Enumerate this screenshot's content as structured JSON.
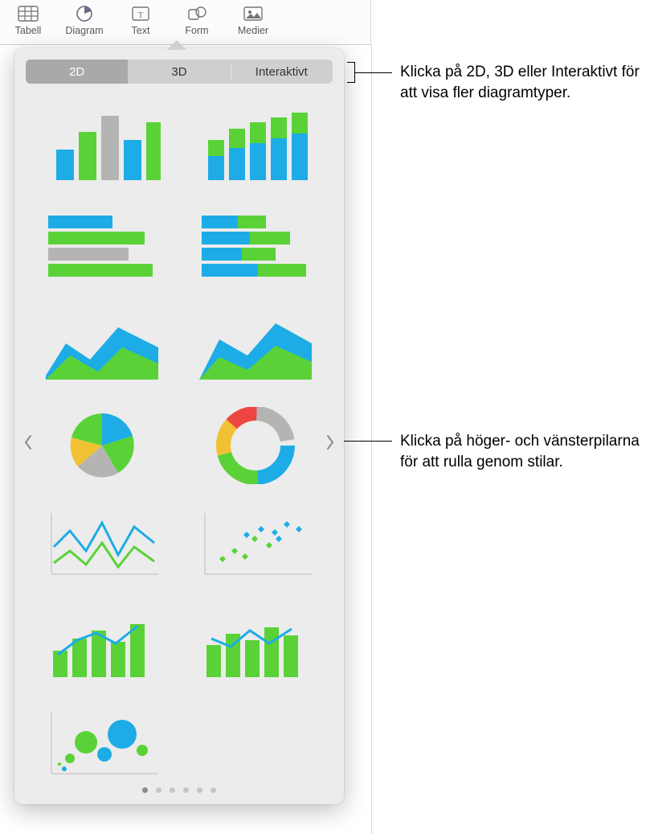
{
  "toolbar": {
    "items": [
      {
        "label": "Tabell"
      },
      {
        "label": "Diagram"
      },
      {
        "label": "Text"
      },
      {
        "label": "Form"
      },
      {
        "label": "Medier"
      }
    ]
  },
  "segmented": {
    "tabs": [
      {
        "label": "2D"
      },
      {
        "label": "3D"
      },
      {
        "label": "Interaktivt"
      }
    ]
  },
  "callouts": {
    "top": "Klicka på 2D, 3D eller Interaktivt för att visa fler diagramtyper.",
    "arrows": "Klicka på höger- och vänsterpilarna för att rulla genom stilar."
  },
  "colors": {
    "blue": "#1dace6",
    "green": "#5ad237",
    "gray": "#b4b4b3",
    "yellow": "#f0c233",
    "red": "#ed4640"
  },
  "pager": {
    "count": 6,
    "active": 0
  }
}
